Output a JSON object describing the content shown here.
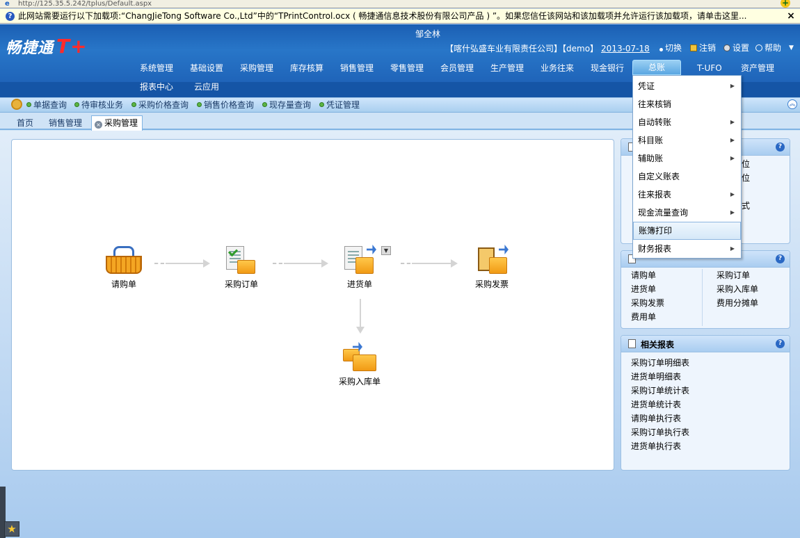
{
  "browser": {
    "address": "http://125.35.5.242/tplus/Default.aspx",
    "info_bar": "此网站需要运行以下加载项:“ChangJieTong Software Co.,Ltd”中的“TPrintControl.ocx ( 畅捷通信息技术股份有限公司产品 ) ”。如果您信任该网站和该加载项并允许运行该加载项，请单击这里...",
    "close": "×"
  },
  "header": {
    "logo_text": "畅捷通",
    "logo_mark": "T+",
    "username": "邹全林",
    "company": "【喀什弘盛车业有限责任公司】【demo】",
    "date": "2013-07-18",
    "tools": [
      "切换",
      "注销",
      "设置",
      "帮助"
    ]
  },
  "nav": {
    "row1": [
      "系统管理",
      "基础设置",
      "采购管理",
      "库存核算",
      "销售管理",
      "零售管理",
      "会员管理",
      "生产管理",
      "业务往来",
      "现金银行",
      "总账",
      "T-UFO",
      "资产管理"
    ],
    "row2": [
      "报表中心",
      "云应用"
    ],
    "active": "总账",
    "more": "▼"
  },
  "quickbar": [
    "单据查询",
    "待审核业务",
    "采购价格查询",
    "销售价格查询",
    "现存量查询",
    "凭证管理"
  ],
  "tabs": [
    "首页",
    "销售管理",
    "采购管理"
  ],
  "flow": {
    "nodes": [
      "请购单",
      "采购订单",
      "进货单",
      "采购发票",
      "采购入库单"
    ]
  },
  "panel_docs": {
    "partial_visible": [
      "位",
      "位",
      "式"
    ],
    "col1": [
      "请购单",
      "进货单",
      "采购发票",
      "费用单"
    ],
    "col2": [
      "采购订单",
      "采购入库单",
      "费用分摊单"
    ]
  },
  "panel_reports": {
    "title": "相关报表",
    "items": [
      "采购订单明细表",
      "进货单明细表",
      "采购订单统计表",
      "进货单统计表",
      "请购单执行表",
      "采购订单执行表",
      "进货单执行表"
    ]
  },
  "menu": [
    {
      "label": "凭证",
      "sub": true
    },
    {
      "label": "往来核销",
      "sub": false
    },
    {
      "label": "自动转账",
      "sub": true
    },
    {
      "label": "科目账",
      "sub": true
    },
    {
      "label": "辅助账",
      "sub": true
    },
    {
      "label": "自定义账表",
      "sub": false
    },
    {
      "label": "往来报表",
      "sub": true
    },
    {
      "label": "现金流量查询",
      "sub": true
    },
    {
      "label": "账簿打印",
      "sub": false,
      "highlighted": true
    },
    {
      "label": "财务报表",
      "sub": true
    }
  ],
  "icons": {
    "help": "?",
    "submenu_arrow": "▶",
    "collapse": "︽",
    "star": "★",
    "dropdown": "▼"
  },
  "colors": {
    "header_blue": "#2876c8",
    "logo_red": "#ff2b2b",
    "content_bg": "#a8caee"
  }
}
